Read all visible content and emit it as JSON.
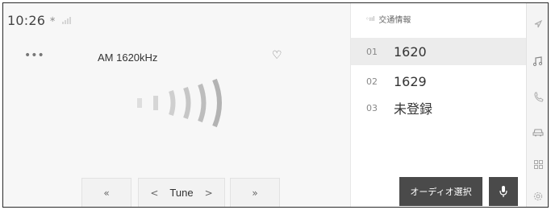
{
  "status": {
    "time": "10:26",
    "bluetooth_glyph": "∗"
  },
  "player": {
    "more_glyph": "•••",
    "station": "AM 1620kHz",
    "favorite_glyph": "♡"
  },
  "controls": {
    "prev_glyph": "«",
    "tune_left": "<",
    "tune_label": "Tune",
    "tune_right": ">",
    "next_glyph": "»"
  },
  "presets": {
    "header": "交通情報",
    "items": [
      {
        "num": "01",
        "label": "1620",
        "selected": true
      },
      {
        "num": "02",
        "label": "1629",
        "selected": false
      },
      {
        "num": "03",
        "label": "未登録",
        "selected": false
      }
    ],
    "audio_select_label": "オーディオ選択"
  },
  "sidebar_icons": [
    "navigation-arrow-icon",
    "music-note-icon",
    "phone-icon",
    "car-icon",
    "apps-grid-icon",
    "settings-gear-icon"
  ],
  "colors": {
    "dark_button": "#4a4a4a",
    "selected_row": "#ececec",
    "accent_line": "#222222"
  }
}
